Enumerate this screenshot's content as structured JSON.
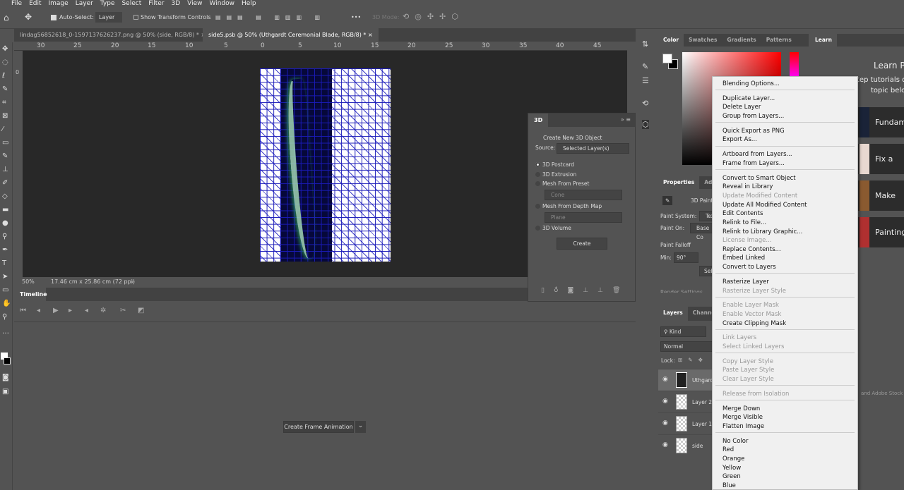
{
  "menubar": [
    "File",
    "Edit",
    "Image",
    "Layer",
    "Type",
    "Select",
    "Filter",
    "3D",
    "View",
    "Window",
    "Help"
  ],
  "options": {
    "auto_select": "Auto-Select:",
    "layer_select": "Layer",
    "show_transform": "Show Transform Controls",
    "more": "•••",
    "mode_3d": "3D Mode:"
  },
  "tabs": [
    {
      "label": "lindag56852618_0-1597137626237.png @ 50% (side, RGB/8) *",
      "close": "×"
    },
    {
      "label": "side5.psb @ 50% (Uthgardt Ceremonial Blade, RGB/8) *",
      "close": "×"
    }
  ],
  "ruler": [
    "30",
    "25",
    "20",
    "15",
    "10",
    "5",
    "0",
    "5",
    "10",
    "15",
    "20",
    "25",
    "30",
    "35",
    "40",
    "45"
  ],
  "vruler": "0",
  "status": {
    "zoom": "50%",
    "size": "17.46 cm x 25.86 cm (72 ppi)",
    "arrow": "›"
  },
  "timeline": {
    "tab": "Timeline",
    "create_button": "Create Frame Animation",
    "dropdown": "⌄"
  },
  "panel3d": {
    "title": "3D",
    "heading": "Create New 3D Object",
    "source_label": "Source:",
    "source_value": "Selected Layer(s)",
    "options": [
      "3D Postcard",
      "3D Extrusion",
      "Mesh From Preset",
      "Mesh From Depth Map",
      "3D Volume"
    ],
    "preset": "Cone",
    "depth": "Plane",
    "create": "Create"
  },
  "color": {
    "tabs": [
      "Color",
      "Swatches",
      "Gradients",
      "Patterns"
    ],
    "fg": "#ffffff",
    "bg": "#000000"
  },
  "properties": {
    "tabs": [
      "Properties",
      "Adjus"
    ],
    "mode": "3D Paint",
    "paint_system_label": "Paint System:",
    "paint_system": "Tex",
    "paint_on_label": "Paint On:",
    "paint_on": "Base Co",
    "falloff": "Paint Falloff",
    "min_label": "Min:",
    "min_value": "90°",
    "select_btn": "Sel",
    "render": "Render Settings"
  },
  "layers": {
    "tabs": [
      "Layers",
      "Channels"
    ],
    "kind": "Kind",
    "blend": "Normal",
    "lock": "Lock:",
    "items": [
      "Uthgard",
      "Layer 2",
      "Layer 1",
      "side"
    ]
  },
  "learn": {
    "tab": "Learn",
    "title": "Learn Pl",
    "subtitle1": "tep tutorials d",
    "subtitle2": "topic belo",
    "cards": [
      "Fundam",
      "Fix a pho",
      "Make cre",
      "Painting"
    ],
    "footer": "and Adobe Stock"
  },
  "context_menu": [
    [
      "Blending Options...",
      0
    ],
    null,
    [
      "Duplicate Layer...",
      0
    ],
    [
      "Delete Layer",
      0
    ],
    [
      "Group from Layers...",
      0
    ],
    null,
    [
      "Quick Export as PNG",
      0
    ],
    [
      "Export As...",
      0
    ],
    null,
    [
      "Artboard from Layers...",
      0
    ],
    [
      "Frame from Layers...",
      0
    ],
    null,
    [
      "Convert to Smart Object",
      0
    ],
    [
      "Reveal in Library",
      0
    ],
    [
      "Update Modified Content",
      1
    ],
    [
      "Update All Modified Content",
      0
    ],
    [
      "Edit Contents",
      0
    ],
    [
      "Relink to File...",
      0
    ],
    [
      "Relink to Library Graphic...",
      0
    ],
    [
      "License Image...",
      1
    ],
    [
      "Replace Contents...",
      0
    ],
    [
      "Embed Linked",
      0
    ],
    [
      "Convert to Layers",
      0
    ],
    null,
    [
      "Rasterize Layer",
      0
    ],
    [
      "Rasterize Layer Style",
      1
    ],
    null,
    [
      "Enable Layer Mask",
      1
    ],
    [
      "Enable Vector Mask",
      1
    ],
    [
      "Create Clipping Mask",
      0
    ],
    null,
    [
      "Link Layers",
      1
    ],
    [
      "Select Linked Layers",
      1
    ],
    null,
    [
      "Copy Layer Style",
      1
    ],
    [
      "Paste Layer Style",
      1
    ],
    [
      "Clear Layer Style",
      1
    ],
    null,
    [
      "Release from Isolation",
      1
    ],
    null,
    [
      "Merge Down",
      0
    ],
    [
      "Merge Visible",
      0
    ],
    [
      "Flatten Image",
      0
    ],
    null,
    [
      "No Color",
      0
    ],
    [
      "Red",
      0
    ],
    [
      "Orange",
      0
    ],
    [
      "Yellow",
      0
    ],
    [
      "Green",
      0
    ],
    [
      "Blue",
      0
    ]
  ]
}
